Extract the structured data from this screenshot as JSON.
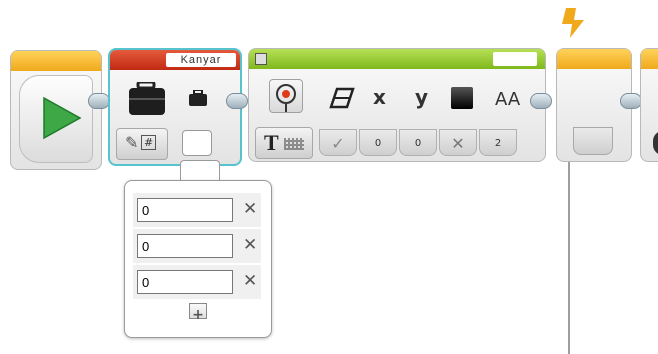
{
  "blocks": {
    "start": {
      "tab_color": "#f0a91b",
      "icon": "play-triangle-icon",
      "accent": "#3ea846"
    },
    "variable": {
      "tab_color": "#d1341d",
      "highlight": "#57c3cf",
      "name": "Kanyar",
      "icons": [
        "briefcase-icon",
        "small-briefcase-icon",
        "pencil-edit-icon",
        "numeric-array-icon"
      ]
    },
    "display": {
      "tab_color": "#8fc623",
      "icons": [
        "target-image-icon",
        "eraser-icon",
        "text-mode-icon"
      ],
      "param_labels": [
        "x",
        "y",
        "AA"
      ],
      "slots": [
        "✓",
        "0",
        "0",
        "✕",
        "2"
      ]
    },
    "wait": {
      "tab_color": "#f0a91b"
    }
  },
  "popup": {
    "rows": [
      "0",
      "0",
      "0"
    ],
    "delete_symbol": "✕",
    "add_symbol": "+"
  }
}
